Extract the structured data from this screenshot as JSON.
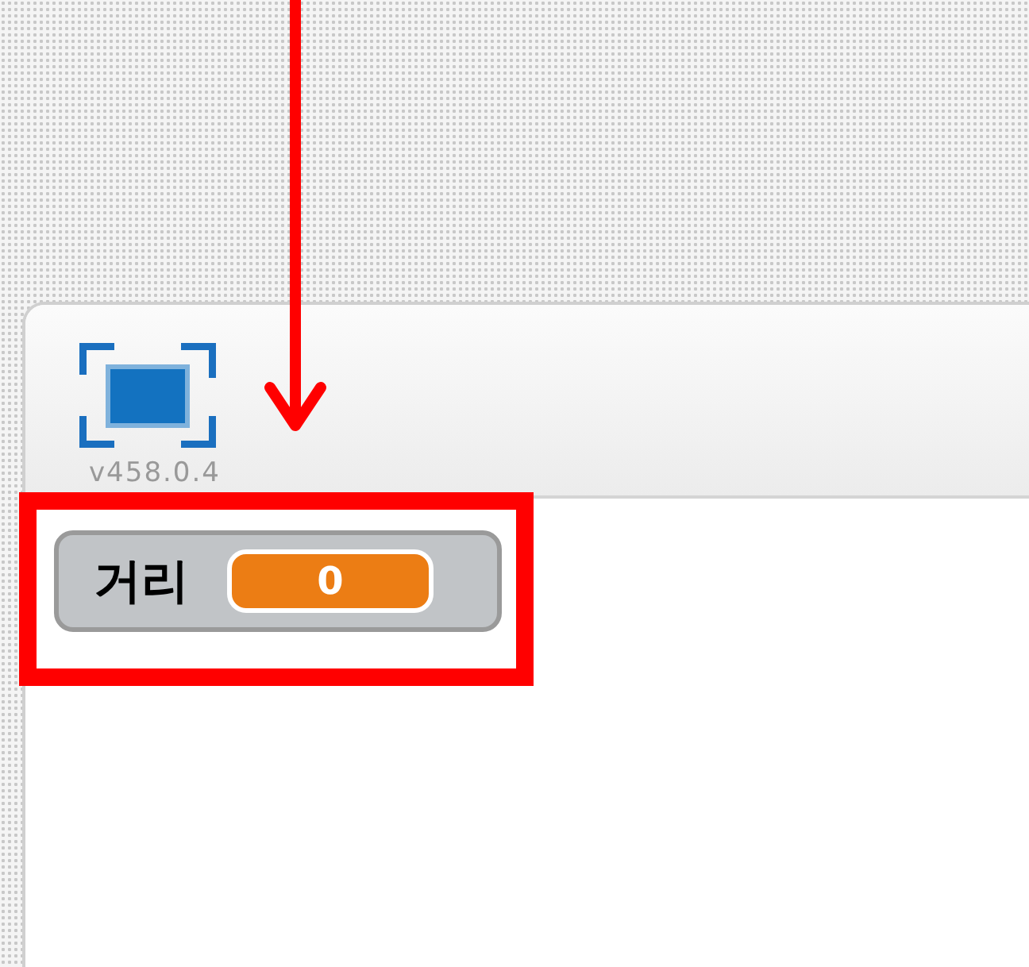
{
  "stage_header": {
    "version": "v458.0.4"
  },
  "monitor": {
    "label": "거리",
    "value": "0"
  },
  "annotations": {
    "arrow": true,
    "highlight_box": true
  }
}
